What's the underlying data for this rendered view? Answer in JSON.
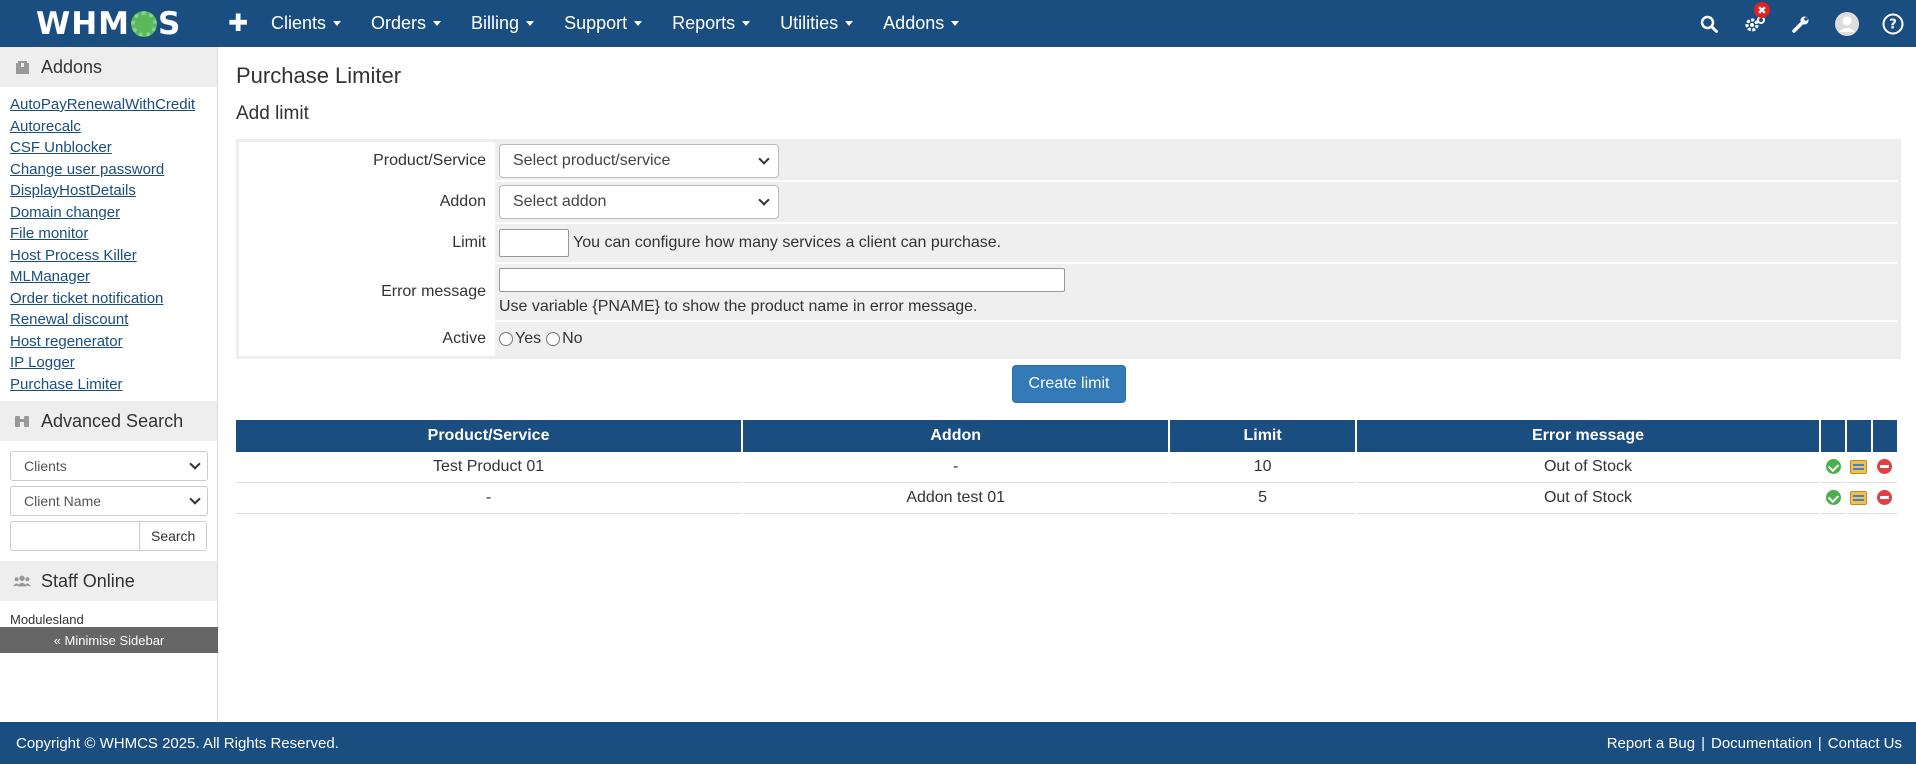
{
  "brand": {
    "logo_left": "WHM",
    "logo_right": "S"
  },
  "topnav": {
    "plus": "✚",
    "items": [
      "Clients",
      "Orders",
      "Billing",
      "Support",
      "Reports",
      "Utilities",
      "Addons"
    ],
    "notification_badge": "✖"
  },
  "sidebar": {
    "addons_title": "Addons",
    "addon_links": [
      "AutoPayRenewalWithCredit",
      "Autorecalc",
      "CSF Unblocker",
      "Change user password",
      "DisplayHostDetails",
      "Domain changer",
      "File monitor",
      "Host Process Killer",
      "MLManager",
      "Order ticket notification",
      "Renewal discount",
      "Host regenerator",
      "IP Logger",
      "Purchase Limiter"
    ],
    "advanced_search_title": "Advanced Search",
    "search_type": "Clients",
    "search_field": "Client Name",
    "search_button": "Search",
    "staff_title": "Staff Online",
    "staff_name": "Modulesland",
    "minimise": "« Minimise Sidebar"
  },
  "main": {
    "title": "Purchase Limiter",
    "subtitle": "Add limit",
    "form": {
      "product_label": "Product/Service",
      "product_placeholder": "Select product/service",
      "addon_label": "Addon",
      "addon_placeholder": "Select addon",
      "limit_label": "Limit",
      "limit_help": "You can configure how many services a client can purchase.",
      "error_label": "Error message",
      "error_help": "Use variable {PNAME} to show the product name in error message.",
      "active_label": "Active",
      "active_yes": "Yes",
      "active_no": "No",
      "submit": "Create limit"
    },
    "table": {
      "headers": [
        "Product/Service",
        "Addon",
        "Limit",
        "Error message"
      ],
      "rows": [
        {
          "product": "Test Product 01",
          "addon": "-",
          "limit": "10",
          "error": "Out of Stock"
        },
        {
          "product": "-",
          "addon": "Addon test 01",
          "limit": "5",
          "error": "Out of Stock"
        }
      ]
    }
  },
  "footer": {
    "copyright": "Copyright © WHMCS 2025. All Rights Reserved.",
    "links": [
      "Report a Bug",
      "Documentation",
      "Contact Us"
    ],
    "separator": "|"
  },
  "colors": {
    "navbar": "#1a4d80",
    "primary_button": "#337ab7",
    "sidebar_header": "#eeeeee"
  }
}
